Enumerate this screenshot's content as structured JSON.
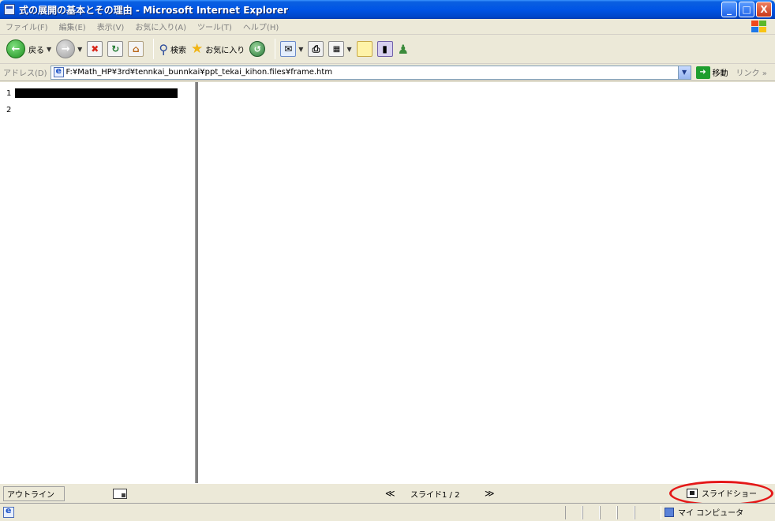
{
  "window": {
    "title": "式の展開の基本とその理由 - Microsoft Internet Explorer",
    "minimize_label": "_",
    "maximize_label": "□",
    "close_label": "X"
  },
  "menu": {
    "items": [
      "ファイル(F)",
      "編集(E)",
      "表示(V)",
      "お気に入り(A)",
      "ツール(T)",
      "ヘルプ(H)"
    ]
  },
  "toolbar": {
    "back_label": "戻る",
    "search_label": "検索",
    "favorites_label": "お気に入り"
  },
  "address": {
    "label": "アドレス(D)",
    "url": "F:¥Math_HP¥3rd¥tennkai_bunnkai¥ppt_tekai_kihon.files¥frame.htm",
    "go_label": "移動",
    "links_label": "リンク »"
  },
  "outline": {
    "rows": [
      {
        "number": "1"
      },
      {
        "number": "2"
      }
    ]
  },
  "navbar": {
    "outline_button_label": "アウトライン",
    "prev_label": "≪",
    "slide_counter": "スライド1 / 2",
    "next_label": "≫",
    "slideshow_label": "スライドショー"
  },
  "status": {
    "zone_label": "マイ コンピュータ"
  },
  "colors": {
    "annotation_ring": "#e41818",
    "titlebar": "#0055e5"
  }
}
